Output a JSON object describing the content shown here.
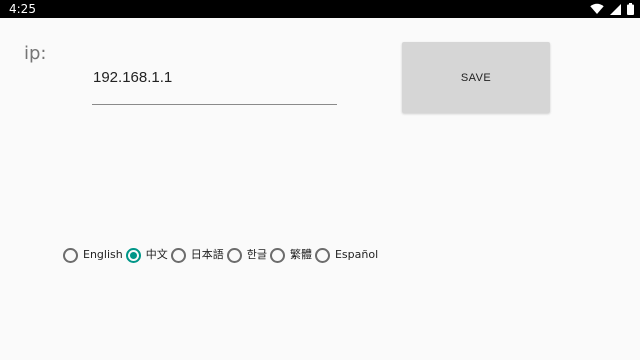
{
  "status_bar": {
    "time": "4:25",
    "icons": [
      "wifi-icon",
      "cellular-icon",
      "battery-icon"
    ]
  },
  "form": {
    "ip_label": "ip:",
    "ip_value": "192.168.1.1",
    "save_label": "SAVE"
  },
  "languages": {
    "selected": "中文",
    "accent_color": "#009688",
    "options": [
      {
        "label": "English",
        "checked": false
      },
      {
        "label": "中文",
        "checked": true
      },
      {
        "label": "日本語",
        "checked": false
      },
      {
        "label": "한글",
        "checked": false
      },
      {
        "label": "繁體",
        "checked": false
      },
      {
        "label": "Español",
        "checked": false
      }
    ]
  }
}
